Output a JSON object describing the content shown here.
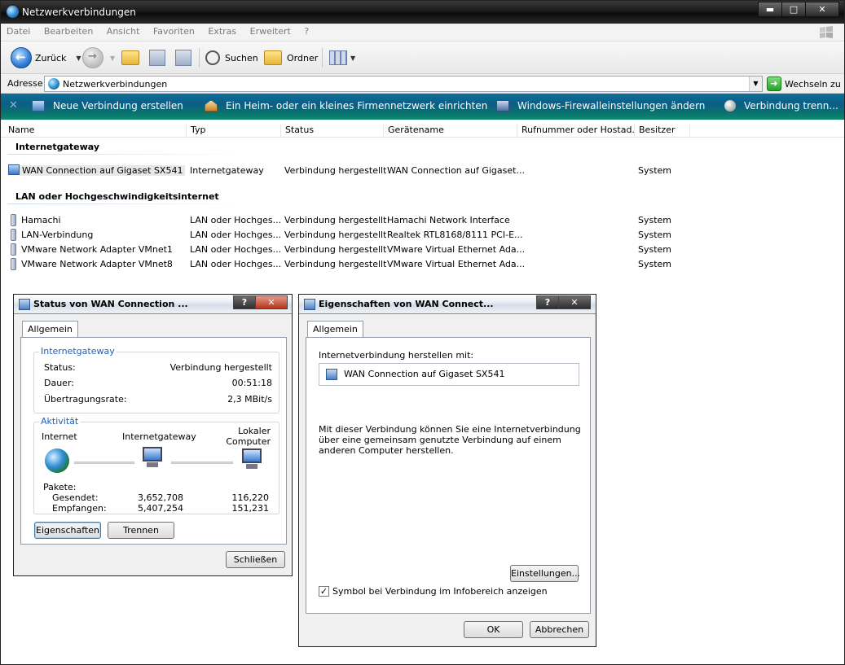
{
  "window": {
    "title": "Netzwerkverbindungen",
    "controls": {
      "minimize": "▬",
      "maximize": "□",
      "close": "✕"
    }
  },
  "menu": [
    "Datei",
    "Bearbeiten",
    "Ansicht",
    "Favoriten",
    "Extras",
    "Erweitert",
    "?"
  ],
  "toolbar": {
    "back": "Zurück",
    "search": "Suchen",
    "folders": "Ordner"
  },
  "address": {
    "label": "Adresse",
    "value": "Netzwerkverbindungen",
    "go": "Wechseln zu"
  },
  "tasks": [
    "Neue Verbindung erstellen",
    "Ein Heim- oder ein kleines Firmennetzwerk einrichten",
    "Windows-Firewalleinstellungen ändern",
    "Verbindung trenn..."
  ],
  "columns": [
    "Name",
    "Typ",
    "Status",
    "Gerätename",
    "Rufnummer oder Hostad...",
    "Besitzer"
  ],
  "groups": [
    {
      "title": "Internetgateway",
      "rows": [
        {
          "name": "WAN Connection auf Gigaset SX541",
          "type": "Internetgateway",
          "status": "Verbindung hergestellt",
          "device": "WAN Connection auf Gigaset...",
          "phone": "",
          "owner": "System"
        }
      ]
    },
    {
      "title": "LAN oder Hochgeschwindigkeitsinternet",
      "rows": [
        {
          "name": "Hamachi",
          "type": "LAN oder Hochges...",
          "status": "Verbindung hergestellt",
          "device": "Hamachi Network Interface",
          "phone": "",
          "owner": "System"
        },
        {
          "name": "LAN-Verbindung",
          "type": "LAN oder Hochges...",
          "status": "Verbindung hergestellt",
          "device": "Realtek RTL8168/8111 PCI-E...",
          "phone": "",
          "owner": "System"
        },
        {
          "name": "VMware Network Adapter VMnet1",
          "type": "LAN oder Hochges...",
          "status": "Verbindung hergestellt",
          "device": "VMware Virtual Ethernet Ada...",
          "phone": "",
          "owner": "System"
        },
        {
          "name": "VMware Network Adapter VMnet8",
          "type": "LAN oder Hochges...",
          "status": "Verbindung hergestellt",
          "device": "VMware Virtual Ethernet Ada...",
          "phone": "",
          "owner": "System"
        }
      ]
    }
  ],
  "status_dialog": {
    "title": "Status von WAN Connection ...",
    "help": "?",
    "close": "✕",
    "tab": "Allgemein",
    "gateway_group": "Internetgateway",
    "status_label": "Status:",
    "status_value": "Verbindung hergestellt",
    "duration_label": "Dauer:",
    "duration_value": "00:51:18",
    "rate_label": "Übertragungsrate:",
    "rate_value": "2,3 MBit/s",
    "activity_group": "Aktivität",
    "node_internet": "Internet",
    "node_gateway": "Internetgateway",
    "node_local_1": "Lokaler",
    "node_local_2": "Computer",
    "packets_label": "Pakete:",
    "sent_label": "Gesendet:",
    "sent_gateway": "3,652,708",
    "sent_local": "116,220",
    "recv_label": "Empfangen:",
    "recv_gateway": "5,407,254",
    "recv_local": "151,231",
    "btn_properties": "Eigenschaften",
    "btn_disconnect": "Trennen",
    "btn_close": "Schließen"
  },
  "props_dialog": {
    "title": "Eigenschaften von WAN Connect...",
    "help": "?",
    "close": "✕",
    "tab": "Allgemein",
    "connect_label": "Internetverbindung herstellen mit:",
    "connection_name": "WAN Connection auf Gigaset SX541",
    "description": "Mit dieser Verbindung können Sie eine Internetverbindung über eine gemeinsam genutzte Verbindung auf einem anderen Computer herstellen.",
    "btn_settings": "Einstellungen...",
    "checkbox_label": "Symbol bei Verbindung im Infobereich anzeigen",
    "checkbox_mark": "✓",
    "btn_ok": "OK",
    "btn_cancel": "Abbrechen"
  }
}
